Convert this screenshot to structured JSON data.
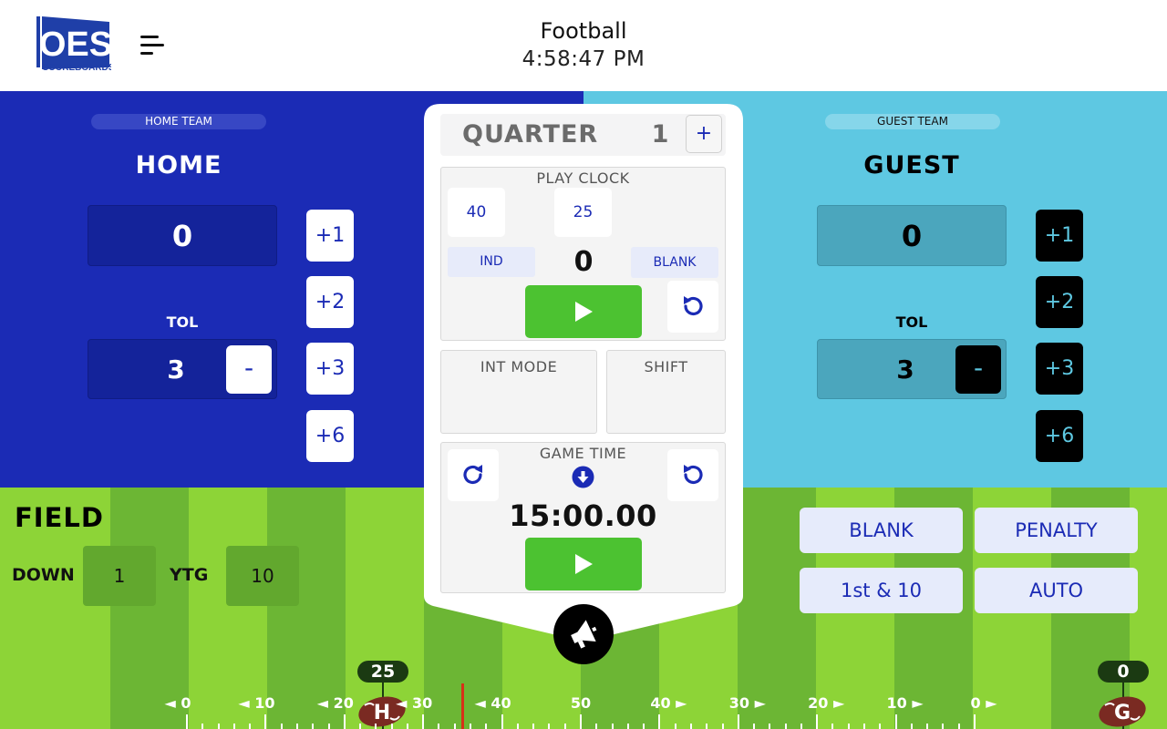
{
  "header": {
    "title": "Football",
    "time": "4:58:47 PM",
    "logo_text": "OES",
    "logo_subtext": "SCOREBOARDS"
  },
  "colors": {
    "home": "#1b2bb5",
    "guest": "#5ec8e2",
    "field_light": "#8dd437",
    "field_dark": "#6cb634",
    "play_green": "#4cc231"
  },
  "home": {
    "tag": "HOME TEAM",
    "name": "HOME",
    "score": "0",
    "tol_label": "TOL",
    "tol": "3",
    "tol_minus": "-",
    "add_buttons": [
      "+1",
      "+2",
      "+3",
      "+6"
    ]
  },
  "guest": {
    "tag": "GUEST TEAM",
    "name": "GUEST",
    "score": "0",
    "tol_label": "TOL",
    "tol": "3",
    "tol_minus": "-",
    "add_buttons": [
      "+1",
      "+2",
      "+3",
      "+6"
    ]
  },
  "quarter": {
    "label": "QUARTER",
    "value": "1",
    "plus": "+"
  },
  "play_clock": {
    "title": "PLAY CLOCK",
    "preset_40": "40",
    "preset_25": "25",
    "ind": "IND",
    "value": "0",
    "blank": "BLANK"
  },
  "modes": {
    "int_mode": "INT MODE",
    "shift": "SHIFT"
  },
  "game_time": {
    "title": "GAME TIME",
    "value": "15:00.00"
  },
  "field": {
    "title": "FIELD",
    "down_label": "DOWN",
    "down": "1",
    "ytg_label": "YTG",
    "ytg": "10",
    "buttons": {
      "blank": "BLANK",
      "penalty": "PENALTY",
      "first_ten": "1st & 10",
      "auto": "AUTO"
    },
    "yard_labels": [
      "◄ 0",
      "◄ 10",
      "◄ 20",
      "◄ 30",
      "◄ 40",
      "50",
      "40 ►",
      "30 ►",
      "20 ►",
      "10 ►",
      "0 ►"
    ],
    "home_marker": {
      "yard": "25",
      "letter": "H"
    },
    "guest_marker": {
      "yard": "0",
      "letter": "G"
    }
  },
  "icons": {
    "menu": "hamburger-icon",
    "play": "play-icon",
    "reset": "reset-icon",
    "redo": "redo-icon",
    "down": "arrow-down-circle-icon",
    "announce": "megaphone-icon",
    "football": "football-icon"
  }
}
